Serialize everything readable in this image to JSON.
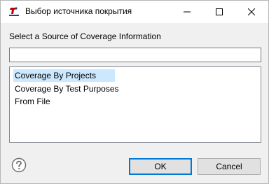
{
  "window": {
    "title": "Выбор источника покрытия",
    "app_icon": "app-logo-icon",
    "controls": {
      "minimize": "minimize-icon",
      "maximize": "maximize-icon",
      "close": "close-icon"
    }
  },
  "prompt": "Select a Source of Coverage Information",
  "filter": {
    "value": "",
    "placeholder": ""
  },
  "sources": [
    {
      "label": "Coverage By Projects",
      "selected": true
    },
    {
      "label": "Coverage By Test Purposes",
      "selected": false
    },
    {
      "label": "From File",
      "selected": false
    }
  ],
  "footer": {
    "help_icon": "help-icon",
    "ok_label": "OK",
    "cancel_label": "Cancel"
  },
  "colors": {
    "selection": "#cce8ff",
    "default_button_border": "#0078d7",
    "dialog_background": "#f0f0f0"
  }
}
